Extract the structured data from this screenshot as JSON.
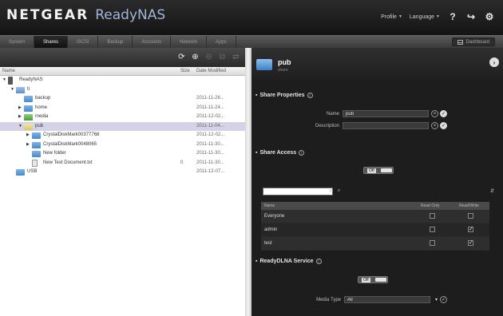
{
  "header": {
    "brand": "NETGEAR",
    "product": "ReadyNAS",
    "profile_label": "Profile",
    "language_label": "Language",
    "help_icon": "?",
    "logout_icon": "↪",
    "settings_icon": "⚙"
  },
  "tabs": [
    {
      "label": "System",
      "active": false
    },
    {
      "label": "Shares",
      "active": true
    },
    {
      "label": "iSCSI",
      "active": false
    },
    {
      "label": "Backup",
      "active": false
    },
    {
      "label": "Accounts",
      "active": false
    },
    {
      "label": "Network",
      "active": false
    },
    {
      "label": "Apps",
      "active": false
    }
  ],
  "dashboard_label": "Dashboard",
  "left": {
    "col_name": "Name",
    "col_size": "Size",
    "col_date": "Date Modified",
    "rows": [
      {
        "name": "ReadyNAS",
        "icon": "nas",
        "level": 0,
        "expand": "▼",
        "size": "",
        "date": "",
        "selected": false
      },
      {
        "name": "ti",
        "icon": "volume",
        "level": 1,
        "expand": "▼",
        "size": "",
        "date": "",
        "selected": false
      },
      {
        "name": "backup",
        "icon": "folder",
        "level": 2,
        "expand": "",
        "size": "",
        "date": "2011-11-26...",
        "selected": false
      },
      {
        "name": "home",
        "icon": "folder",
        "level": 2,
        "expand": "▶",
        "size": "",
        "date": "2011-11-24...",
        "selected": false
      },
      {
        "name": "media",
        "icon": "media",
        "level": 2,
        "expand": "▶",
        "size": "",
        "date": "2011-12-02...",
        "selected": false
      },
      {
        "name": "pub",
        "icon": "folder-open",
        "level": 2,
        "expand": "▼",
        "size": "",
        "date": "2011-11-04...",
        "selected": true
      },
      {
        "name": "CrystalDiskMark00377768",
        "icon": "folder",
        "level": 3,
        "expand": "▶",
        "size": "",
        "date": "2011-12-02...",
        "selected": false
      },
      {
        "name": "CrystalDiskMark0048065",
        "icon": "folder",
        "level": 3,
        "expand": "▶",
        "size": "",
        "date": "2011-11-30...",
        "selected": false
      },
      {
        "name": "New folder",
        "icon": "folder",
        "level": 3,
        "expand": "",
        "size": "",
        "date": "2011-11-30...",
        "selected": false
      },
      {
        "name": "New Text Document.txt",
        "icon": "doc",
        "level": 3,
        "expand": "",
        "size": "0",
        "date": "2011-11-30...",
        "selected": false
      },
      {
        "name": "USB",
        "icon": "folder",
        "level": 1,
        "expand": "",
        "size": "",
        "date": "2011-12-07...",
        "selected": false
      }
    ]
  },
  "share": {
    "title": "pub",
    "subtitle": "share",
    "close_icon": "›",
    "properties_title": "Share Properties",
    "name_label": "Name",
    "name_value": "pub",
    "description_label": "Description",
    "description_value": "",
    "access_title": "Share Access",
    "access_toggle": "Off",
    "table_headers": [
      "Name",
      "Read Only",
      "Read/Write"
    ],
    "access_rows": [
      {
        "name": "Everyone",
        "read_only": false,
        "read_write": false
      },
      {
        "name": "admin",
        "read_only": false,
        "read_write": true
      },
      {
        "name": "test",
        "read_only": false,
        "read_write": true
      }
    ],
    "dlna_title": "ReadyDLNA Service",
    "dlna_toggle": "Off",
    "media_type_label": "Media Type",
    "media_type_value": "All"
  }
}
